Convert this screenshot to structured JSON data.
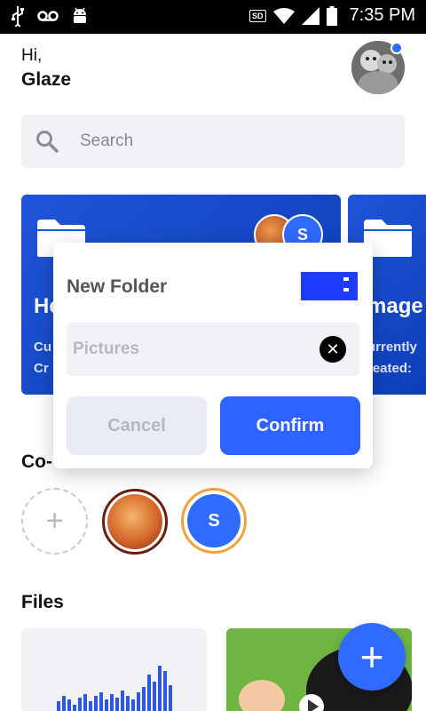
{
  "status_bar": {
    "time": "7:35 PM",
    "sd_label": "SD"
  },
  "header": {
    "greeting": "Hi,",
    "user_name": "Glaze"
  },
  "search": {
    "placeholder": "Search"
  },
  "folders": [
    {
      "title_visible": "He",
      "line1_visible": "Cu",
      "line2_visible": "Cr",
      "collaborator_initial": "S"
    },
    {
      "title_visible": "mage",
      "line1_visible": "urrently",
      "line2_visible": "reated:"
    }
  ],
  "collaborators": {
    "section_title": "Co-",
    "initial": "S"
  },
  "files": {
    "section_title": "Files"
  },
  "dialog": {
    "title": "New Folder",
    "input_placeholder": "Pictures",
    "cancel_label": "Cancel",
    "confirm_label": "Confirm"
  },
  "colors": {
    "accent": "#2f6bff",
    "card_blue": "#1e55d6",
    "ring_orange": "#f3a13a"
  }
}
